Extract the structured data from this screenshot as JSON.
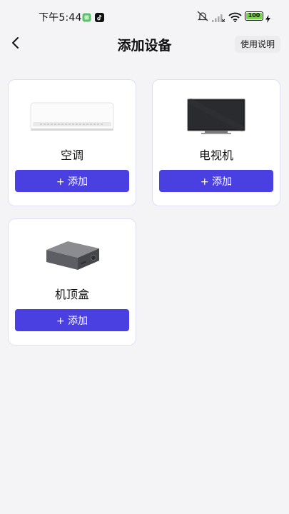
{
  "status_bar": {
    "time": "下午5:44",
    "battery": "100",
    "icons": [
      "app-green-icon",
      "tiktok-icon",
      "mute-icon",
      "signal-icon",
      "wifi-icon",
      "battery-icon",
      "charging-icon"
    ]
  },
  "nav": {
    "title": "添加设备",
    "help_label": "使用说明",
    "back_icon": "chevron-left-icon"
  },
  "devices": [
    {
      "name": "空调",
      "image_icon": "air-conditioner-image",
      "add_label": "+ 添加"
    },
    {
      "name": "电视机",
      "image_icon": "television-image",
      "add_label": "+ 添加"
    },
    {
      "name": "机顶盒",
      "image_icon": "set-top-box-image",
      "add_label": "+ 添加"
    }
  ],
  "colors": {
    "accent": "#4a3fe0",
    "background": "#f4f4f6",
    "card_border": "#dde0f2"
  }
}
